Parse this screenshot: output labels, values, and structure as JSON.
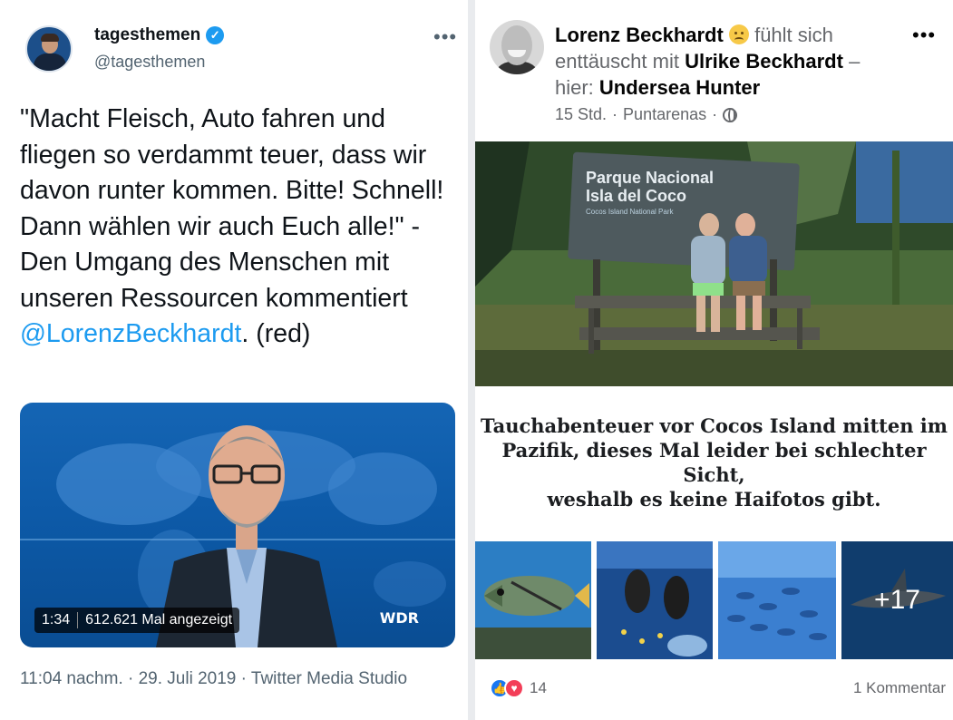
{
  "twitter": {
    "account_name": "tagesthemen",
    "handle": "@tagesthemen",
    "more_icon": "more-horizontal-icon",
    "tweet_text": "\"Macht Fleisch, Auto fahren und fliegen so verdammt teuer, dass wir davon runter kommen. Bitte! Schnell! Dann wählen wir auch Euch alle!\" - Den Umgang des Menschen mit unseren Ressourcen kommentiert",
    "mention": "@LorenzBeckhardt",
    "tweet_tail": ". (red)",
    "video": {
      "duration": "1:34",
      "views": "612.621 Mal angezeigt",
      "channel_logo": "WDR"
    },
    "meta": "11:04 nachm. · 29. Juli 2019 · Twitter Media Studio"
  },
  "facebook": {
    "author": "Lorenz Beckhardt",
    "feeling": "fühlt sich enttäuscht mit",
    "tagged": "Ulrike Beckhardt",
    "location_prefix": "– hier:",
    "location": "Undersea Hunter",
    "time": "15 Std.",
    "place": "Puntarenas",
    "privacy_icon": "globe-icon",
    "sign_line1": "Parque Nacional",
    "sign_line2": "Isla del Coco",
    "sign_line3": "Cocos Island National Park",
    "caption_lines": [
      "Tauchabenteuer vor Cocos Island mitten im",
      "Pazifik, dieses Mal leider bei schlechter",
      "Sicht,",
      "weshalb es keine Haifotos gibt."
    ],
    "more_photos": "+17",
    "reaction_count": "14",
    "comments": "1 Kommentar"
  }
}
